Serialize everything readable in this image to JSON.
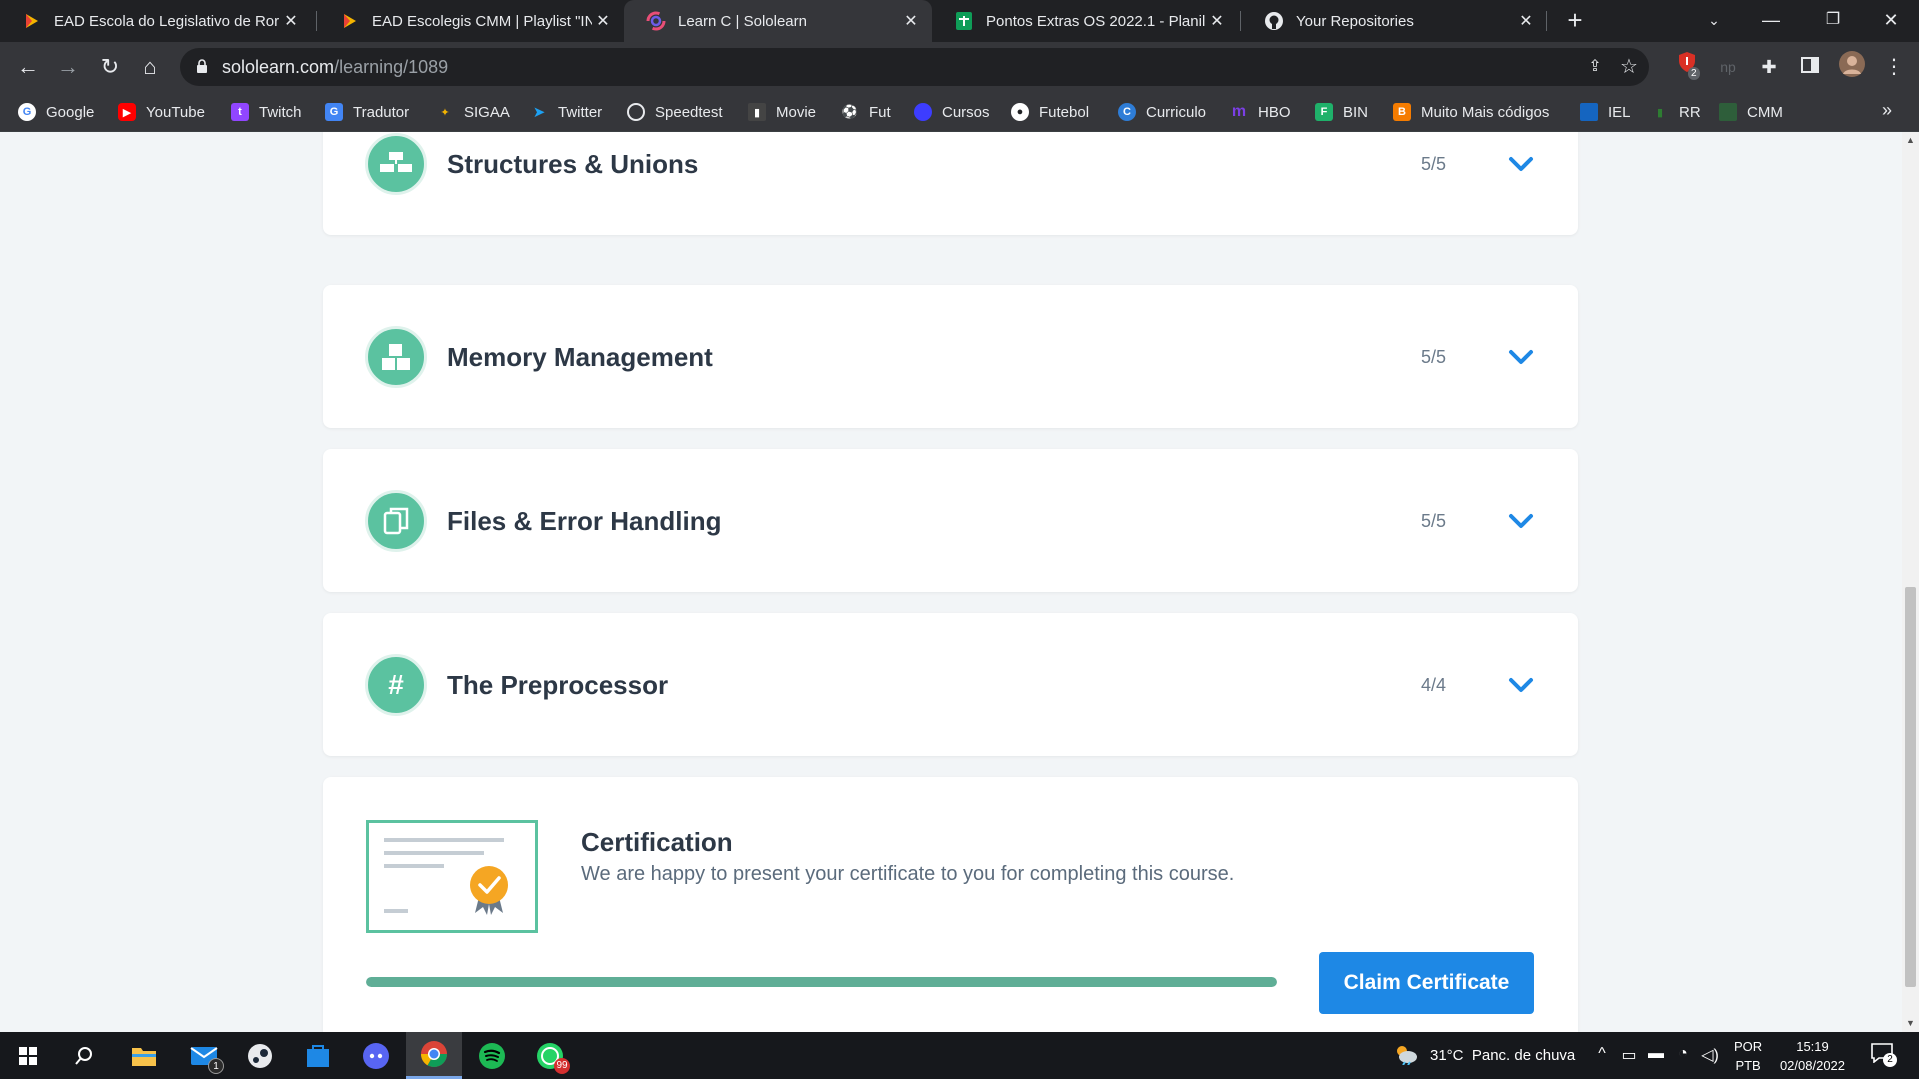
{
  "browser": {
    "tabs": [
      {
        "title": "EAD Escola do Legislativo de Ror",
        "active": false,
        "favicon": "play-icon"
      },
      {
        "title": "EAD Escolegis CMM | Playlist \"IN",
        "active": false,
        "favicon": "play-icon"
      },
      {
        "title": "Learn C | Sololearn",
        "active": true,
        "favicon": "sololearn-icon"
      },
      {
        "title": "Pontos Extras OS 2022.1 - Planilh",
        "active": false,
        "favicon": "sheets-icon"
      },
      {
        "title": "Your Repositories",
        "active": false,
        "favicon": "github-icon"
      }
    ],
    "address": {
      "domain": "sololearn.com",
      "path": "/learning/1089"
    },
    "extension_badge": "2",
    "bookmarks": [
      "Google",
      "YouTube",
      "Twitch",
      "Tradutor",
      "SIGAA",
      "Twitter",
      "Speedtest",
      "Movie",
      "Fut",
      "Cursos",
      "Futebol",
      "Curriculo",
      "HBO",
      "BIN",
      "Muito Mais códigos",
      "IEL",
      "RR",
      "CMM"
    ]
  },
  "modules": [
    {
      "title": "Structures & Unions",
      "progress": "5/5",
      "icon": "structures-icon"
    },
    {
      "title": "Memory Management",
      "progress": "5/5",
      "icon": "memory-blocks-icon"
    },
    {
      "title": "Files & Error Handling",
      "progress": "5/5",
      "icon": "files-icon"
    },
    {
      "title": "The Preprocessor",
      "progress": "4/4",
      "icon": "hash-icon",
      "glyph": "#"
    }
  ],
  "certification": {
    "title": "Certification",
    "description": "We are happy to present your certificate to you for completing this course.",
    "progress_fraction": 1.0,
    "button_label": "Claim Certificate"
  },
  "taskbar": {
    "mail_badge": "1",
    "whatsapp_badge": "99",
    "weather": {
      "temp": "31°C",
      "desc": "Panc. de chuva"
    },
    "lang": {
      "line1": "POR",
      "line2": "PTB"
    },
    "time": "15:19",
    "date": "02/08/2022",
    "notification_badge": "2"
  },
  "colors": {
    "accent_green": "#5bc2a0",
    "link_blue": "#1e88e5",
    "title_dark": "#2d3846"
  }
}
